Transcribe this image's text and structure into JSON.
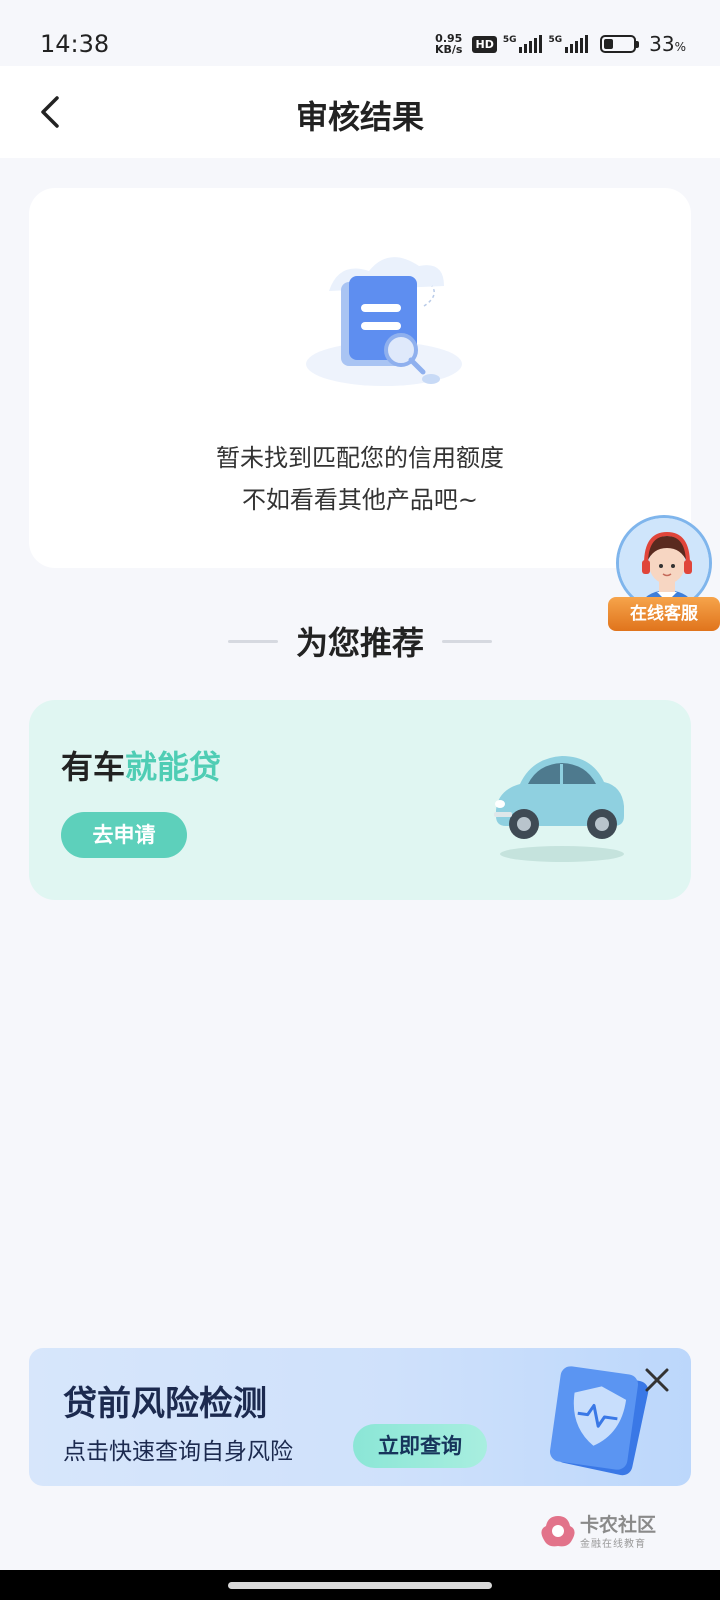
{
  "status_bar": {
    "time": "14:38",
    "net_speed_value": "0.95",
    "net_speed_unit": "KB/s",
    "hd_badge": "HD",
    "sim1_network": "5G",
    "sim2_network": "5G",
    "battery_percent": "33",
    "battery_unit": "%"
  },
  "header": {
    "title": "审核结果",
    "back_icon": "chevron-left-icon"
  },
  "result": {
    "illustration": "document-search-icon",
    "line1": "暂未找到匹配您的信用额度",
    "line2": "不如看看其他产品吧~"
  },
  "customer_service": {
    "label": "在线客服",
    "avatar_icon": "headset-agent-icon"
  },
  "recommend": {
    "title": "为您推荐"
  },
  "product": {
    "title_dark": "有车",
    "title_accent": "就能贷",
    "apply_label": "去申请",
    "image_icon": "car-icon"
  },
  "risk_banner": {
    "title": "贷前风险检测",
    "subtitle": "点击快速查询自身风险",
    "query_label": "立即查询",
    "icon": "shield-report-icon",
    "close_icon": "close-icon"
  },
  "watermark": {
    "title": "卡农社区",
    "subtitle": "金融在线教育"
  },
  "colors": {
    "accent_teal": "#4fcdb4",
    "button_teal": "#5dd0bb",
    "card_teal_bg": "#e0f6f2",
    "page_bg": "#f6f7fb",
    "cs_orange": "#e0741c"
  }
}
